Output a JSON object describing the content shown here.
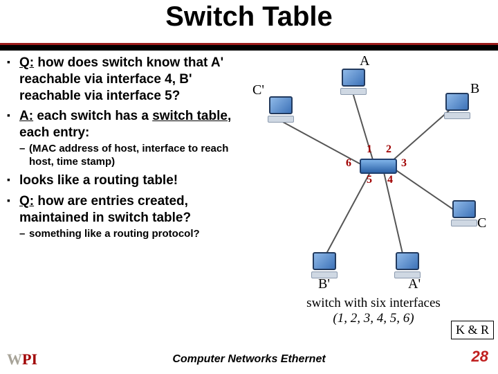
{
  "title": "Switch Table",
  "bullets": {
    "q1_label": "Q:",
    "q1_text": " how does switch know that A' reachable via interface 4, B' reachable via interface 5?",
    "a1_label": "A:",
    "a1_text": "  each switch has a ",
    "a1_em": "switch table",
    "a1_tail": ", each entry:",
    "sub1": "(MAC address of host, interface to reach host, time stamp)",
    "b3": "looks like a routing table!",
    "q2_label": "Q:",
    "q2_text": " how are entries created, maintained in switch table?",
    "sub2": "something like a routing protocol?"
  },
  "hosts": {
    "A": "A",
    "B": "B",
    "C": "C",
    "Ap": "A'",
    "Bp": "B'",
    "Cp": "C'"
  },
  "ports": {
    "p1": "1",
    "p2": "2",
    "p3": "3",
    "p4": "4",
    "p5": "5",
    "p6": "6"
  },
  "caption1": "switch with six interfaces",
  "caption2": "(1, 2, 3, 4, 5, 6)",
  "kr": "K & R",
  "footer_center": "Computer Networks     Ethernet",
  "page": "28",
  "logo": {
    "w": "W",
    "p": "P",
    "i": "I"
  }
}
